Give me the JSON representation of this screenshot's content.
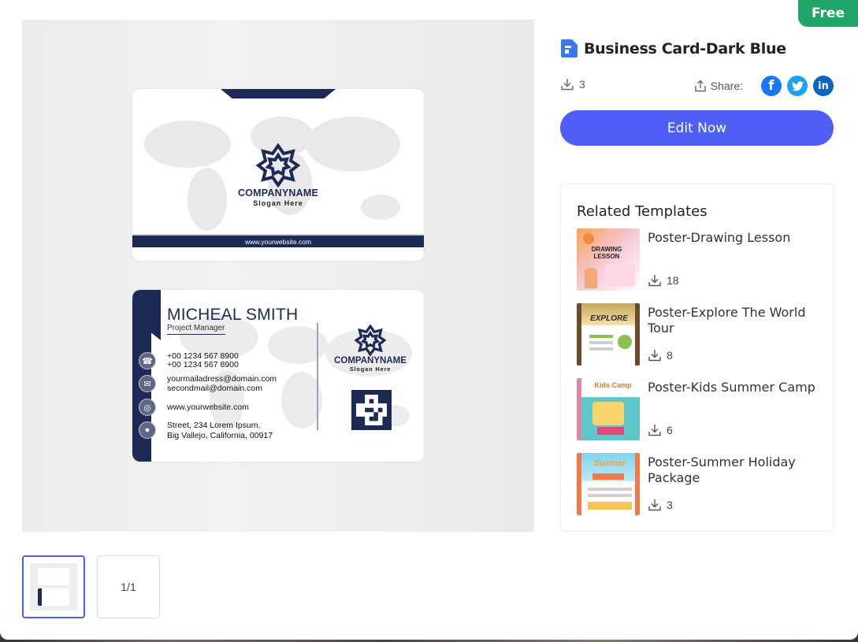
{
  "badge": "Free",
  "preview": {
    "front": {
      "company": "COMPANYNAME",
      "slogan": "Slogan Here",
      "website": "www.yourwebsite.com"
    },
    "back": {
      "name": "MICHEAL SMITH",
      "title": "Project Manager",
      "phone1": "+00 1234 567 8900",
      "phone2": "+00 1234 567 8900",
      "email1": "yourmailadress@domain.com",
      "email2": "secondmail@domain.com",
      "website": "www.yourwebsite.com",
      "address1": "Street, 234 Lorem Ipsum,",
      "address2": "Big Vallejo, California, 00917",
      "company": "COMPANYNAME",
      "slogan": "Slogan Here"
    },
    "brand_color": "#1c2a55"
  },
  "pager": {
    "label": "1/1"
  },
  "template": {
    "title": "Business Card-Dark Blue",
    "downloads": "3",
    "share_label": "Share:",
    "edit_label": "Edit Now",
    "accent": "#4f5ff5"
  },
  "related": {
    "heading": "Related Templates",
    "items": [
      {
        "name": "Poster-Drawing Lesson",
        "downloads": "18",
        "thumb_text": "DRAWING LESSON"
      },
      {
        "name": "Poster-Explore The World Tour",
        "downloads": "8",
        "thumb_text": "EXPLORE"
      },
      {
        "name": "Poster-Kids Summer Camp",
        "downloads": "6",
        "thumb_text": "Kids Camp"
      },
      {
        "name": "Poster-Summer Holiday Package",
        "downloads": "3",
        "thumb_text": "Summer"
      }
    ]
  }
}
